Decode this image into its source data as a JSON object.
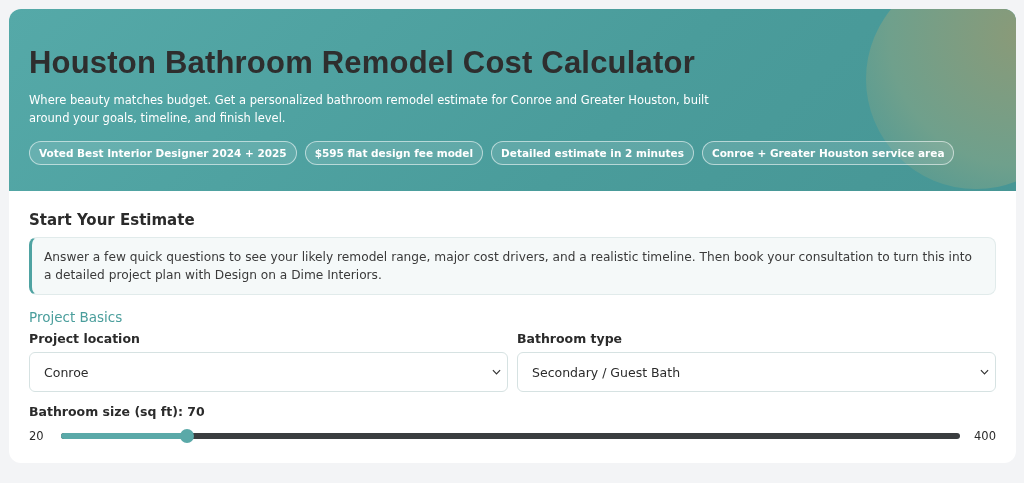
{
  "hero": {
    "title": "Houston Bathroom Remodel Cost Calculator",
    "subtitle": "Where beauty matches budget. Get a personalized bathroom remodel estimate for Conroe and Greater Houston, built around your goals, timeline, and finish level.",
    "badges": [
      "Voted Best Interior Designer 2024 + 2025",
      "$595 flat design fee model",
      "Detailed estimate in 2 minutes",
      "Conroe + Greater Houston service area"
    ]
  },
  "form": {
    "heading": "Start Your Estimate",
    "intro": "Answer a few quick questions to see your likely remodel range, major cost drivers, and a realistic timeline. Then book your consultation to turn this into a detailed project plan with Design on a Dime Interiors.",
    "section": "Project Basics",
    "selects": [
      {
        "label": "Project location",
        "value": "Conroe"
      },
      {
        "label": "Bathroom type",
        "value": "Secondary / Guest Bath"
      }
    ],
    "slider": {
      "label": "Bathroom size (sq ft): 70",
      "min": "20",
      "max": "400",
      "level": 0.14
    }
  }
}
